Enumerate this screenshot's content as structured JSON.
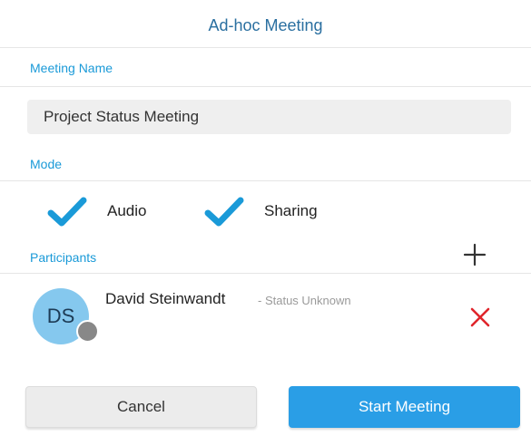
{
  "dialog": {
    "title": "Ad-hoc Meeting"
  },
  "meeting_name": {
    "label": "Meeting Name",
    "value": "Project Status Meeting"
  },
  "mode": {
    "label": "Mode",
    "options": [
      {
        "label": "Audio",
        "checked": true
      },
      {
        "label": "Sharing",
        "checked": true
      }
    ]
  },
  "participants": {
    "label": "Participants",
    "add_icon": "plus-icon",
    "items": [
      {
        "initials": "DS",
        "name": "David Steinwandt",
        "status": "- Status Unknown",
        "presence": "unknown",
        "remove_icon": "close-icon"
      }
    ]
  },
  "actions": {
    "cancel_label": "Cancel",
    "start_label": "Start Meeting"
  },
  "colors": {
    "accent": "#1a9ad8",
    "title": "#2a6fa0",
    "primary_button": "#2a9ee6",
    "remove": "#e0252b",
    "avatar": "#85c8ee",
    "presence_unknown": "#888888"
  }
}
